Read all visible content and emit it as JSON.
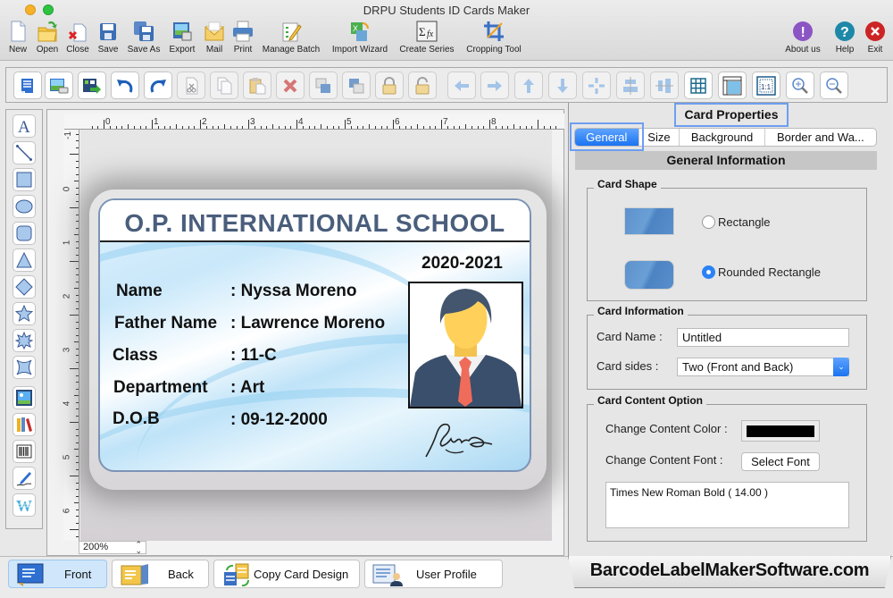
{
  "window": {
    "title": "DRPU Students ID Cards Maker"
  },
  "main_toolbar": [
    {
      "id": "new",
      "label": "New",
      "icon": "new-file-icon"
    },
    {
      "id": "open",
      "label": "Open",
      "icon": "open-folder-icon"
    },
    {
      "id": "close",
      "label": "Close",
      "icon": "close-file-icon"
    },
    {
      "id": "save",
      "label": "Save",
      "icon": "save-icon"
    },
    {
      "id": "save-as",
      "label": "Save As",
      "icon": "save-as-icon"
    },
    {
      "id": "export",
      "label": "Export",
      "icon": "export-icon"
    },
    {
      "id": "mail",
      "label": "Mail",
      "icon": "mail-icon"
    },
    {
      "id": "print",
      "label": "Print",
      "icon": "printer-icon"
    },
    {
      "id": "manage-batch",
      "label": "Manage Batch",
      "icon": "manage-batch-icon"
    },
    {
      "id": "import-wizard",
      "label": "Import Wizard",
      "icon": "import-wizard-icon"
    },
    {
      "id": "create-series",
      "label": "Create Series",
      "icon": "sigma-fx-icon"
    },
    {
      "id": "cropping-tool",
      "label": "Cropping Tool",
      "icon": "crop-icon"
    },
    {
      "id": "about-us",
      "label": "About us",
      "icon": "info-exclamation-icon"
    },
    {
      "id": "help",
      "label": "Help",
      "icon": "help-question-icon"
    },
    {
      "id": "exit",
      "label": "Exit",
      "icon": "exit-x-icon"
    }
  ],
  "edit_toolbar": [
    {
      "name": "properties-icon",
      "enabled": true
    },
    {
      "name": "insert-image-icon",
      "enabled": true
    },
    {
      "name": "export-image-icon",
      "enabled": true
    },
    {
      "name": "undo-icon",
      "enabled": true
    },
    {
      "name": "redo-icon",
      "enabled": true
    },
    {
      "name": "cut-icon",
      "enabled": false
    },
    {
      "name": "copy-icon",
      "enabled": false
    },
    {
      "name": "paste-icon",
      "enabled": false
    },
    {
      "name": "delete-icon",
      "enabled": false
    },
    {
      "name": "bring-to-front-icon",
      "enabled": false
    },
    {
      "name": "send-to-back-icon",
      "enabled": false
    },
    {
      "name": "lock-icon",
      "enabled": false
    },
    {
      "name": "unlock-icon",
      "enabled": false
    },
    {
      "name": "move-left-icon",
      "enabled": false
    },
    {
      "name": "move-right-icon",
      "enabled": false
    },
    {
      "name": "move-up-icon",
      "enabled": false
    },
    {
      "name": "move-down-icon",
      "enabled": false
    },
    {
      "name": "center-icon",
      "enabled": false
    },
    {
      "name": "align-horizontal-center-icon",
      "enabled": false
    },
    {
      "name": "align-vertical-center-icon",
      "enabled": false
    },
    {
      "name": "grid-icon",
      "enabled": true
    },
    {
      "name": "ruler-icon",
      "enabled": true
    },
    {
      "name": "actual-size-icon",
      "enabled": true
    },
    {
      "name": "zoom-in-icon",
      "enabled": true
    },
    {
      "name": "zoom-out-icon",
      "enabled": true
    }
  ],
  "tool_palette": [
    "text-tool-icon",
    "line-tool-icon",
    "rectangle-tool-icon",
    "ellipse-tool-icon",
    "rounded-rectangle-tool-icon",
    "triangle-tool-icon",
    "diamond-tool-icon",
    "star-tool-icon",
    "burst-tool-icon",
    "four-point-star-tool-icon",
    "image-tool-icon",
    "library-tool-icon",
    "barcode-tool-icon",
    "signature-tool-icon",
    "watermark-tool-icon"
  ],
  "rulers": {
    "top": [
      "0",
      "1",
      "2",
      "3",
      "4",
      "5",
      "6",
      "7",
      "8"
    ],
    "left": [
      "-1",
      "0",
      "1",
      "2",
      "3",
      "4",
      "5",
      "6"
    ]
  },
  "zoom": {
    "value": "200%"
  },
  "card": {
    "school_name": "O.P. INTERNATIONAL SCHOOL",
    "year": "2020-2021",
    "fields": [
      {
        "label": "Name",
        "value": ": Nyssa Moreno"
      },
      {
        "label": "Father Name",
        "value": ": Lawrence Moreno"
      },
      {
        "label": "Class",
        "value": ": 11-C"
      },
      {
        "label": "Department",
        "value": ": Art"
      },
      {
        "label": "D.O.B",
        "value": ": 09-12-2000"
      }
    ],
    "colors": {
      "title": "#4a5e7c",
      "border": "#7d93b6"
    }
  },
  "properties": {
    "title": "Card Properties",
    "tabs": [
      {
        "label": "General",
        "active": true
      },
      {
        "label": "Size",
        "active": false
      },
      {
        "label": "Background",
        "active": false
      },
      {
        "label": "Border and Wa...",
        "active": false
      }
    ],
    "section_title": "General Information",
    "card_shape": {
      "title": "Card Shape",
      "options": [
        {
          "label": "Rectangle",
          "checked": false
        },
        {
          "label": "Rounded Rectangle",
          "checked": true
        }
      ]
    },
    "card_information": {
      "title": "Card Information",
      "card_name_label": "Card Name :",
      "card_name_value": "Untitled",
      "card_sides_label": "Card sides :",
      "card_sides_value": "Two (Front and Back)"
    },
    "card_content": {
      "title": "Card Content Option",
      "color_label": "Change Content Color :",
      "color_value": "#000000",
      "font_label": "Change Content Font :",
      "select_font_button": "Select Font",
      "font_value": "Times New Roman Bold ( 14.00 )"
    }
  },
  "bottom_bar": {
    "buttons": [
      {
        "label": "Front",
        "active": true
      },
      {
        "label": "Back",
        "active": false
      },
      {
        "label": "Copy Card Design",
        "active": false
      },
      {
        "label": "User Profile",
        "active": false
      }
    ],
    "brand": "BarcodeLabelMakerSoftware.com"
  },
  "accent_color": "#1a73f0"
}
